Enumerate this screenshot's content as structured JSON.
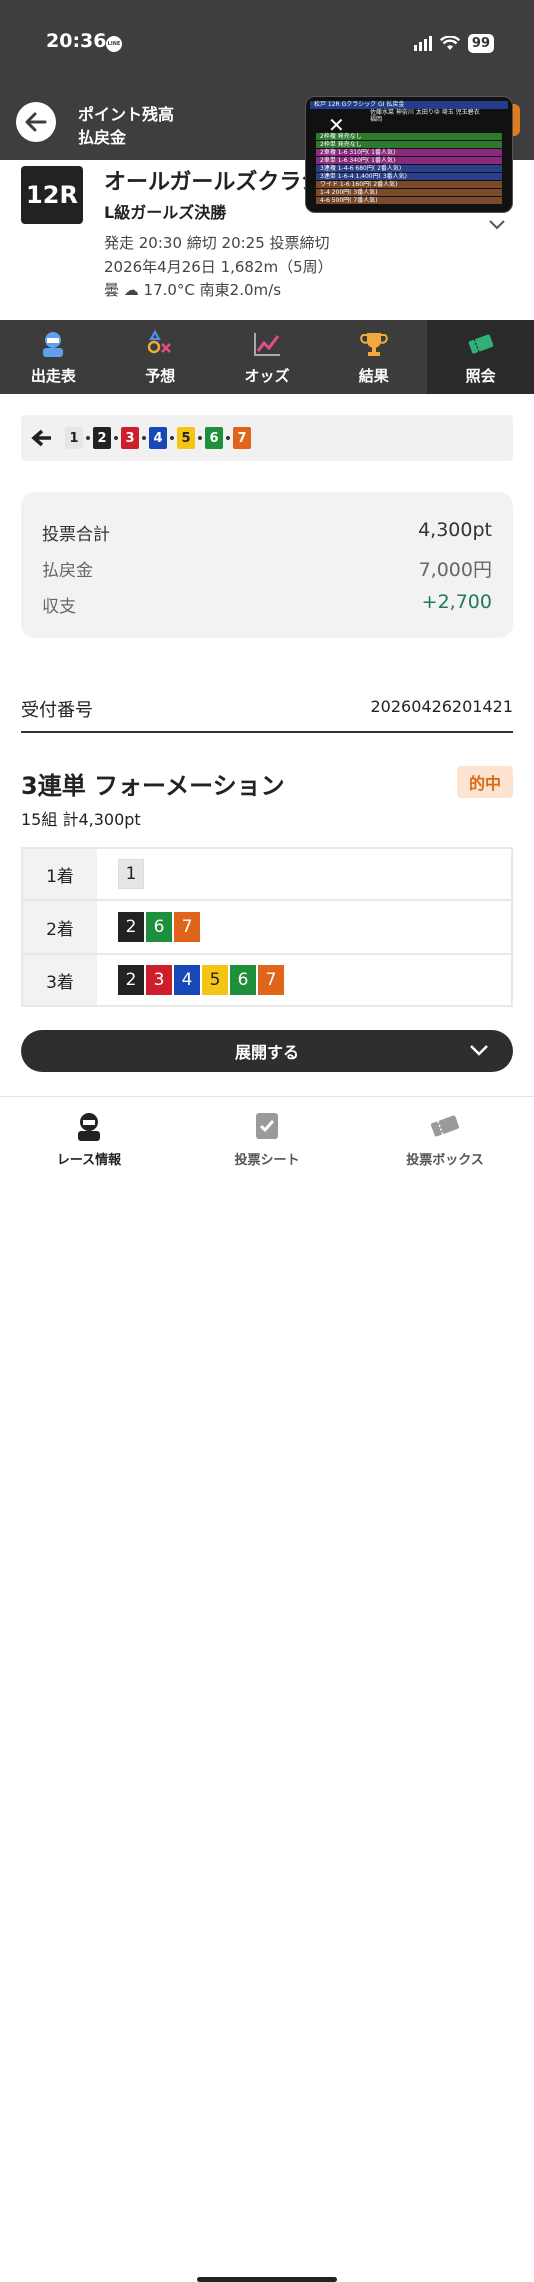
{
  "status_bar": {
    "time": "20:36",
    "app_badge": "LINE",
    "battery": "99"
  },
  "header": {
    "points_label": "ポイント残高",
    "page_label": "払戻金"
  },
  "race": {
    "number": "12R",
    "name": "オールガールズクラシ",
    "subtitle": "L級ガールズ決勝",
    "schedule": "発走 20:30 締切 20:25 投票締切",
    "date_distance": "2026年4月26日 1,682m（5周）",
    "weather": "曇 ☁ 17.0°C 南東2.0m/s"
  },
  "pip": {
    "header": "松戸  12R   Gクラシック GⅠ   払戻金",
    "names": "佐藤水菜  神奈川  太田りゆ  埼玉  児玉碧衣  福岡",
    "rows": [
      {
        "text": "2枠複 発売なし",
        "color": "#2d7a2d"
      },
      {
        "text": "2枠単 発売なし",
        "color": "#2d7a2d"
      },
      {
        "text": "2車複 1-6   310円( 1番人気)",
        "color": "#8a2a7e"
      },
      {
        "text": "2車単 1-6   340円( 1番人気)",
        "color": "#8a2a7e"
      },
      {
        "text": "3連複 1-4-6 680円( 2番人気)",
        "color": "#2a3f8a"
      },
      {
        "text": "3連単 1-6-4 1,400円( 3番人気)",
        "color": "#2a3f8a"
      },
      {
        "text": "ワイド 1-6  160円( 2番人気)",
        "color": "#7a4a2a"
      },
      {
        "text": "     1-4   200円( 3番人気)",
        "color": "#7a4a2a"
      },
      {
        "text": "     4-6   500円( 7番人気)",
        "color": "#7a4a2a"
      }
    ]
  },
  "tabs": [
    {
      "label": "出走表",
      "icon": "racer-icon"
    },
    {
      "label": "予想",
      "icon": "prediction-icon"
    },
    {
      "label": "オッズ",
      "icon": "odds-chart-icon"
    },
    {
      "label": "結果",
      "icon": "trophy-icon"
    },
    {
      "label": "照会",
      "icon": "ticket-icon",
      "active": true
    }
  ],
  "race_nav": {
    "numbers": [
      "1",
      "2",
      "3",
      "4",
      "5",
      "6",
      "7"
    ],
    "colors": [
      "#e6e6e6",
      "#222222",
      "#cc1f2b",
      "#1848b8",
      "#f6c513",
      "#1e8f3a",
      "#e0641a"
    ],
    "text_colors": [
      "#222",
      "#fff",
      "#fff",
      "#fff",
      "#222",
      "#fff",
      "#fff"
    ]
  },
  "summary": {
    "total_label": "投票合計",
    "total_value": "4,300pt",
    "payout_label": "払戻金",
    "payout_value": "7,000円",
    "balance_label": "収支",
    "balance_value": "+2,700",
    "balance_color": "#1f7a55"
  },
  "receipt": {
    "label": "受付番号",
    "value": "20260426201421"
  },
  "bet": {
    "title": "3連単 フォーメーション",
    "hit_label": "的中",
    "subtitle": "15組 計4,300pt",
    "rows": [
      {
        "label": "1着",
        "nums": [
          "1"
        ]
      },
      {
        "label": "2着",
        "nums": [
          "2",
          "6",
          "7"
        ]
      },
      {
        "label": "3着",
        "nums": [
          "2",
          "3",
          "4",
          "5",
          "6",
          "7"
        ]
      }
    ]
  },
  "expand_label": "展開する",
  "bottom_nav": [
    {
      "label": "レース情報",
      "icon": "racer-icon"
    },
    {
      "label": "投票シート",
      "icon": "vote-sheet-icon"
    },
    {
      "label": "投票ボックス",
      "icon": "ticket-box-icon"
    }
  ]
}
